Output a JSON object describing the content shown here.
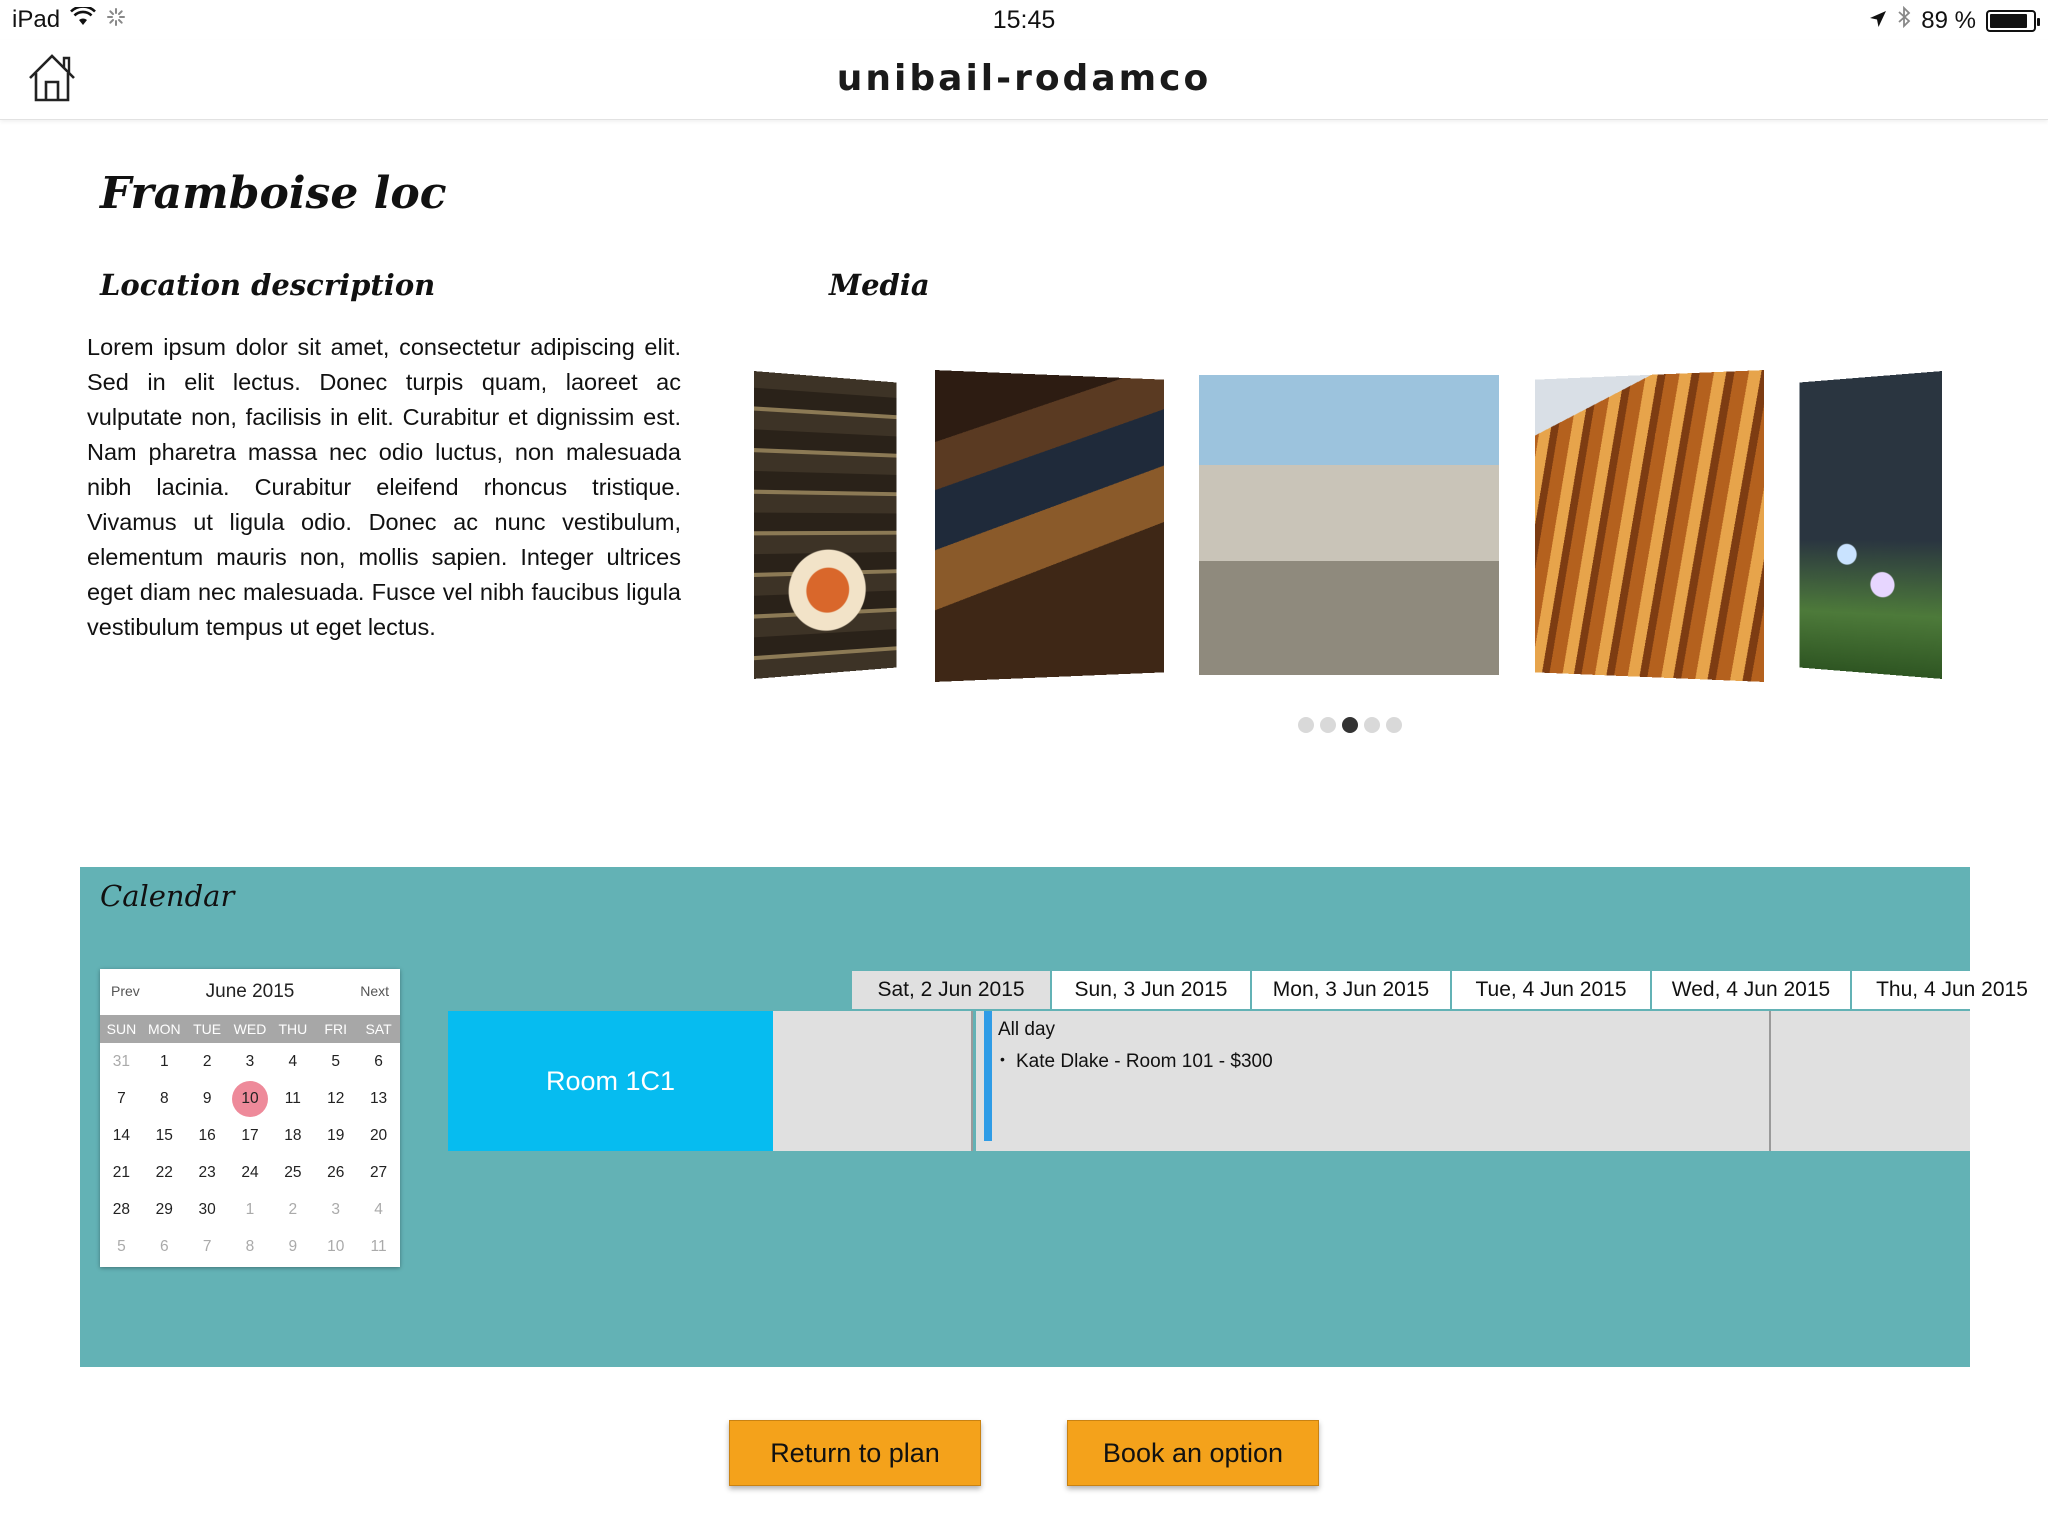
{
  "status_bar": {
    "device": "iPad",
    "time": "15:45",
    "battery_percent": "89 %",
    "battery_level": 0.89,
    "icons": [
      "wifi-icon",
      "activity-spinner-icon",
      "location-arrow-icon",
      "bluetooth-icon",
      "battery-icon"
    ]
  },
  "nav": {
    "brand": "unibail-rodamco",
    "home_icon": "home-icon"
  },
  "page": {
    "title": "Framboise loc",
    "description_heading": "Location description",
    "description": "Lorem ipsum dolor sit amet, consectetur adipiscing elit. Sed in elit lectus. Donec turpis quam, laoreet ac vulputate non, facilisis in elit. Curabitur et dignissim est. Nam pharetra massa nec odio luctus, non malesuada nibh lacinia. Curabitur eleifend rhoncus tristique. Vivamus ut ligula odio. Donec ac nunc vestibulum, elementum mauris non, mollis sapien. Integer ultrices eget diam nec malesuada. Fusce vel nibh faucibus ligula vestibulum tempus ut eget lectus.",
    "media_heading": "Media"
  },
  "media": {
    "slide_count": 5,
    "active_index": 2
  },
  "calendar": {
    "heading": "Calendar",
    "mini": {
      "prev_label": "Prev",
      "next_label": "Next",
      "month_label": "June 2015",
      "weekdays": [
        "SUN",
        "MON",
        "TUE",
        "WED",
        "THU",
        "FRI",
        "SAT"
      ],
      "weeks": [
        [
          "31",
          "1",
          "2",
          "3",
          "4",
          "5",
          "6"
        ],
        [
          "7",
          "8",
          "9",
          "10",
          "11",
          "12",
          "13"
        ],
        [
          "14",
          "15",
          "16",
          "17",
          "18",
          "19",
          "20"
        ],
        [
          "21",
          "22",
          "23",
          "24",
          "25",
          "26",
          "27"
        ],
        [
          "28",
          "29",
          "30",
          "1",
          "2",
          "3",
          "4"
        ],
        [
          "5",
          "6",
          "7",
          "8",
          "9",
          "10",
          "11"
        ]
      ],
      "selected_day": "10"
    },
    "days": [
      "Sat, 2 Jun 2015",
      "Sun, 3 Jun 2015",
      "Mon, 3 Jun 2015",
      "Tue, 4 Jun 2015",
      "Wed, 4 Jun 2015",
      "Thu, 4 Jun 2015"
    ],
    "room": "Room 1C1",
    "event": {
      "all_day_label": "All day",
      "item": "Kate Dlake - Room 101 - $300"
    }
  },
  "actions": {
    "return_label": "Return to plan",
    "book_label": "Book an option"
  },
  "colors": {
    "calendar_bg": "#63b2b5",
    "room_bg": "#06bcf0",
    "button_bg": "#f4a21b",
    "event_bar": "#2f9ce6",
    "today_circle": "#ee8a9a"
  }
}
